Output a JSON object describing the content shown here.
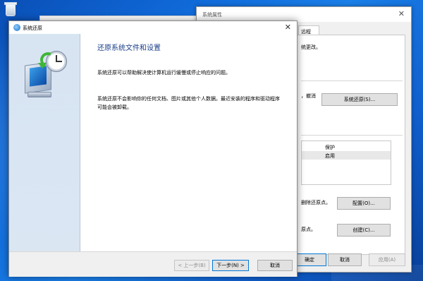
{
  "system_properties": {
    "title": "系统属性",
    "tab_label": "远程",
    "text_changes": "统更改。",
    "text_undo": "，撤消",
    "restore_button": "系统还原(S)...",
    "table_header": "保护",
    "table_row_value": "启用",
    "text_delete_points": "删除还原点。",
    "configure_button": "配置(O)...",
    "text_create_points": "原点。",
    "create_button": "创建(C)...",
    "ok_button": "确定",
    "cancel_button": "取消",
    "apply_button": "应用(A)"
  },
  "wizard": {
    "title": "系统还原",
    "heading": "还原系统文件和设置",
    "paragraph1": "系统还原可以帮助解决使计算机运行缓慢或停止响应的问题。",
    "paragraph2": "系统还原不会影响你的任何文档、图片或其他个人数据。最近安装的程序和驱动程序可能会被卸载。",
    "back_button": "< 上一步(B)",
    "next_button": "下一步(N) >",
    "cancel_button": "取消"
  }
}
